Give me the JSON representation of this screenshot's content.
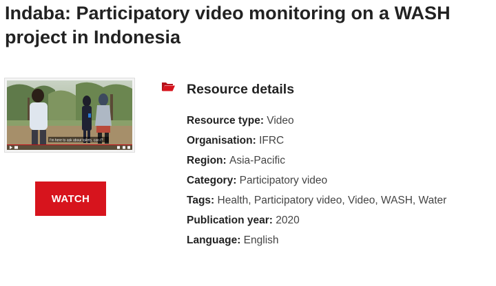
{
  "page": {
    "title": "Indaba: Participatory video monitoring on a WASH project in Indonesia"
  },
  "video": {
    "caption": "I'm here to ask about toilets, can I?",
    "watch_label": "WATCH"
  },
  "details": {
    "heading": "Resource details",
    "items": [
      {
        "label": "Resource type",
        "value": "Video"
      },
      {
        "label": "Organisation",
        "value": "IFRC"
      },
      {
        "label": "Region",
        "value": "Asia-Pacific"
      },
      {
        "label": "Category",
        "value": "Participatory video"
      },
      {
        "label": "Tags",
        "value": "Health, Participatory video, Video, WASH, Water"
      },
      {
        "label": "Publication year",
        "value": "2020"
      },
      {
        "label": "Language",
        "value": "English"
      }
    ]
  },
  "colors": {
    "accent": "#d7141d",
    "text": "#222222"
  },
  "icons": {
    "section_icon": "folder-open-icon"
  }
}
